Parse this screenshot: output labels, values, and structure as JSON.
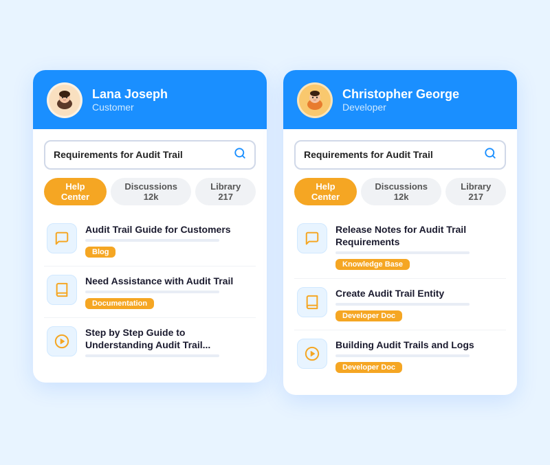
{
  "cards": [
    {
      "id": "lana",
      "header": {
        "name": "Lana Joseph",
        "role": "Customer",
        "avatar_type": "lana",
        "avatar_emoji": "👩"
      },
      "search": {
        "value": "Requirements for Audit Trail",
        "placeholder": "Search..."
      },
      "tabs": [
        {
          "label": "Help Center",
          "active": true
        },
        {
          "label": "Discussions 12k",
          "active": false
        },
        {
          "label": "Library 217",
          "active": false
        }
      ],
      "results": [
        {
          "icon": "chat",
          "title": "Audit Trail Guide for Customers",
          "tag": "Blog",
          "tag_class": "tag-blog"
        },
        {
          "icon": "book",
          "title": "Need Assistance with Audit Trail",
          "tag": "Documentation",
          "tag_class": "tag-docs"
        },
        {
          "icon": "play",
          "title": "Step by Step Guide to Understanding Audit Trail...",
          "tag": null,
          "tag_class": null
        }
      ]
    },
    {
      "id": "chris",
      "header": {
        "name": "Christopher George",
        "role": "Developer",
        "avatar_type": "chris",
        "avatar_emoji": "👦"
      },
      "search": {
        "value": "Requirements for Audit Trail",
        "placeholder": "Search..."
      },
      "tabs": [
        {
          "label": "Help Center",
          "active": true
        },
        {
          "label": "Discussions 12k",
          "active": false
        },
        {
          "label": "Library 217",
          "active": false
        }
      ],
      "results": [
        {
          "icon": "chat",
          "title": "Release Notes for Audit Trail Requirements",
          "tag": "Knowledge Base",
          "tag_class": "tag-kb"
        },
        {
          "icon": "book",
          "title": "Create Audit Trail Entity",
          "tag": "Developer Doc",
          "tag_class": "tag-devdoc"
        },
        {
          "icon": "play",
          "title": "Building Audit Trails and Logs",
          "tag": "Developer Doc",
          "tag_class": "tag-devdoc"
        }
      ]
    }
  ]
}
